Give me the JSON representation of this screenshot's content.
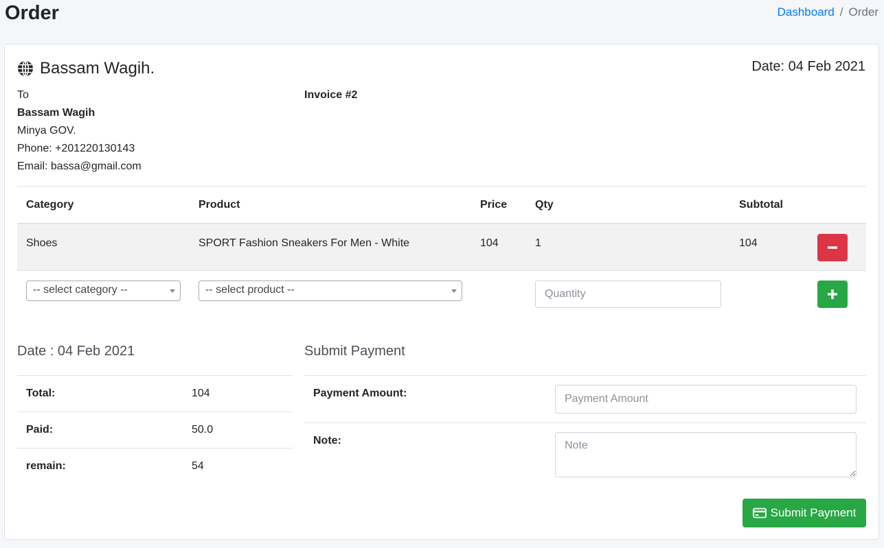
{
  "header": {
    "title": "Order",
    "breadcrumb": {
      "home": "Dashboard",
      "separator": "/",
      "current": "Order"
    }
  },
  "invoice": {
    "company": "Bassam Wagih.",
    "date": "Date: 04 Feb 2021",
    "to_label": "To",
    "customer_name": "Bassam Wagih",
    "address": "Minya GOV.",
    "phone": "Phone: +201220130143",
    "email": "Email: bassa@gmail.com",
    "number": "Invoice #2"
  },
  "items": {
    "columns": [
      "Category",
      "Product",
      "Price",
      "Qty",
      "Subtotal"
    ],
    "rows": [
      {
        "category": "Shoes",
        "product": "SPORT Fashion Sneakers For Men - White",
        "price": "104",
        "qty": "1",
        "subtotal": "104"
      }
    ],
    "select_category": "-- select category --",
    "select_product": "-- select product --",
    "quantity_placeholder": "Quantity"
  },
  "summary": {
    "title": "Date : 04 Feb 2021",
    "total_label": "Total:",
    "total_value": "104",
    "paid_label": "Paid:",
    "paid_value": "50.0",
    "remain_label": "remain:",
    "remain_value": "54"
  },
  "payment": {
    "title": "Submit Payment",
    "amount_label": "Payment Amount:",
    "amount_placeholder": "Payment Amount",
    "note_label": "Note:",
    "note_placeholder": "Note",
    "submit_label": "Submit Payment"
  },
  "colors": {
    "primary": "#007bff",
    "success": "#28a745",
    "danger": "#dc3545"
  }
}
